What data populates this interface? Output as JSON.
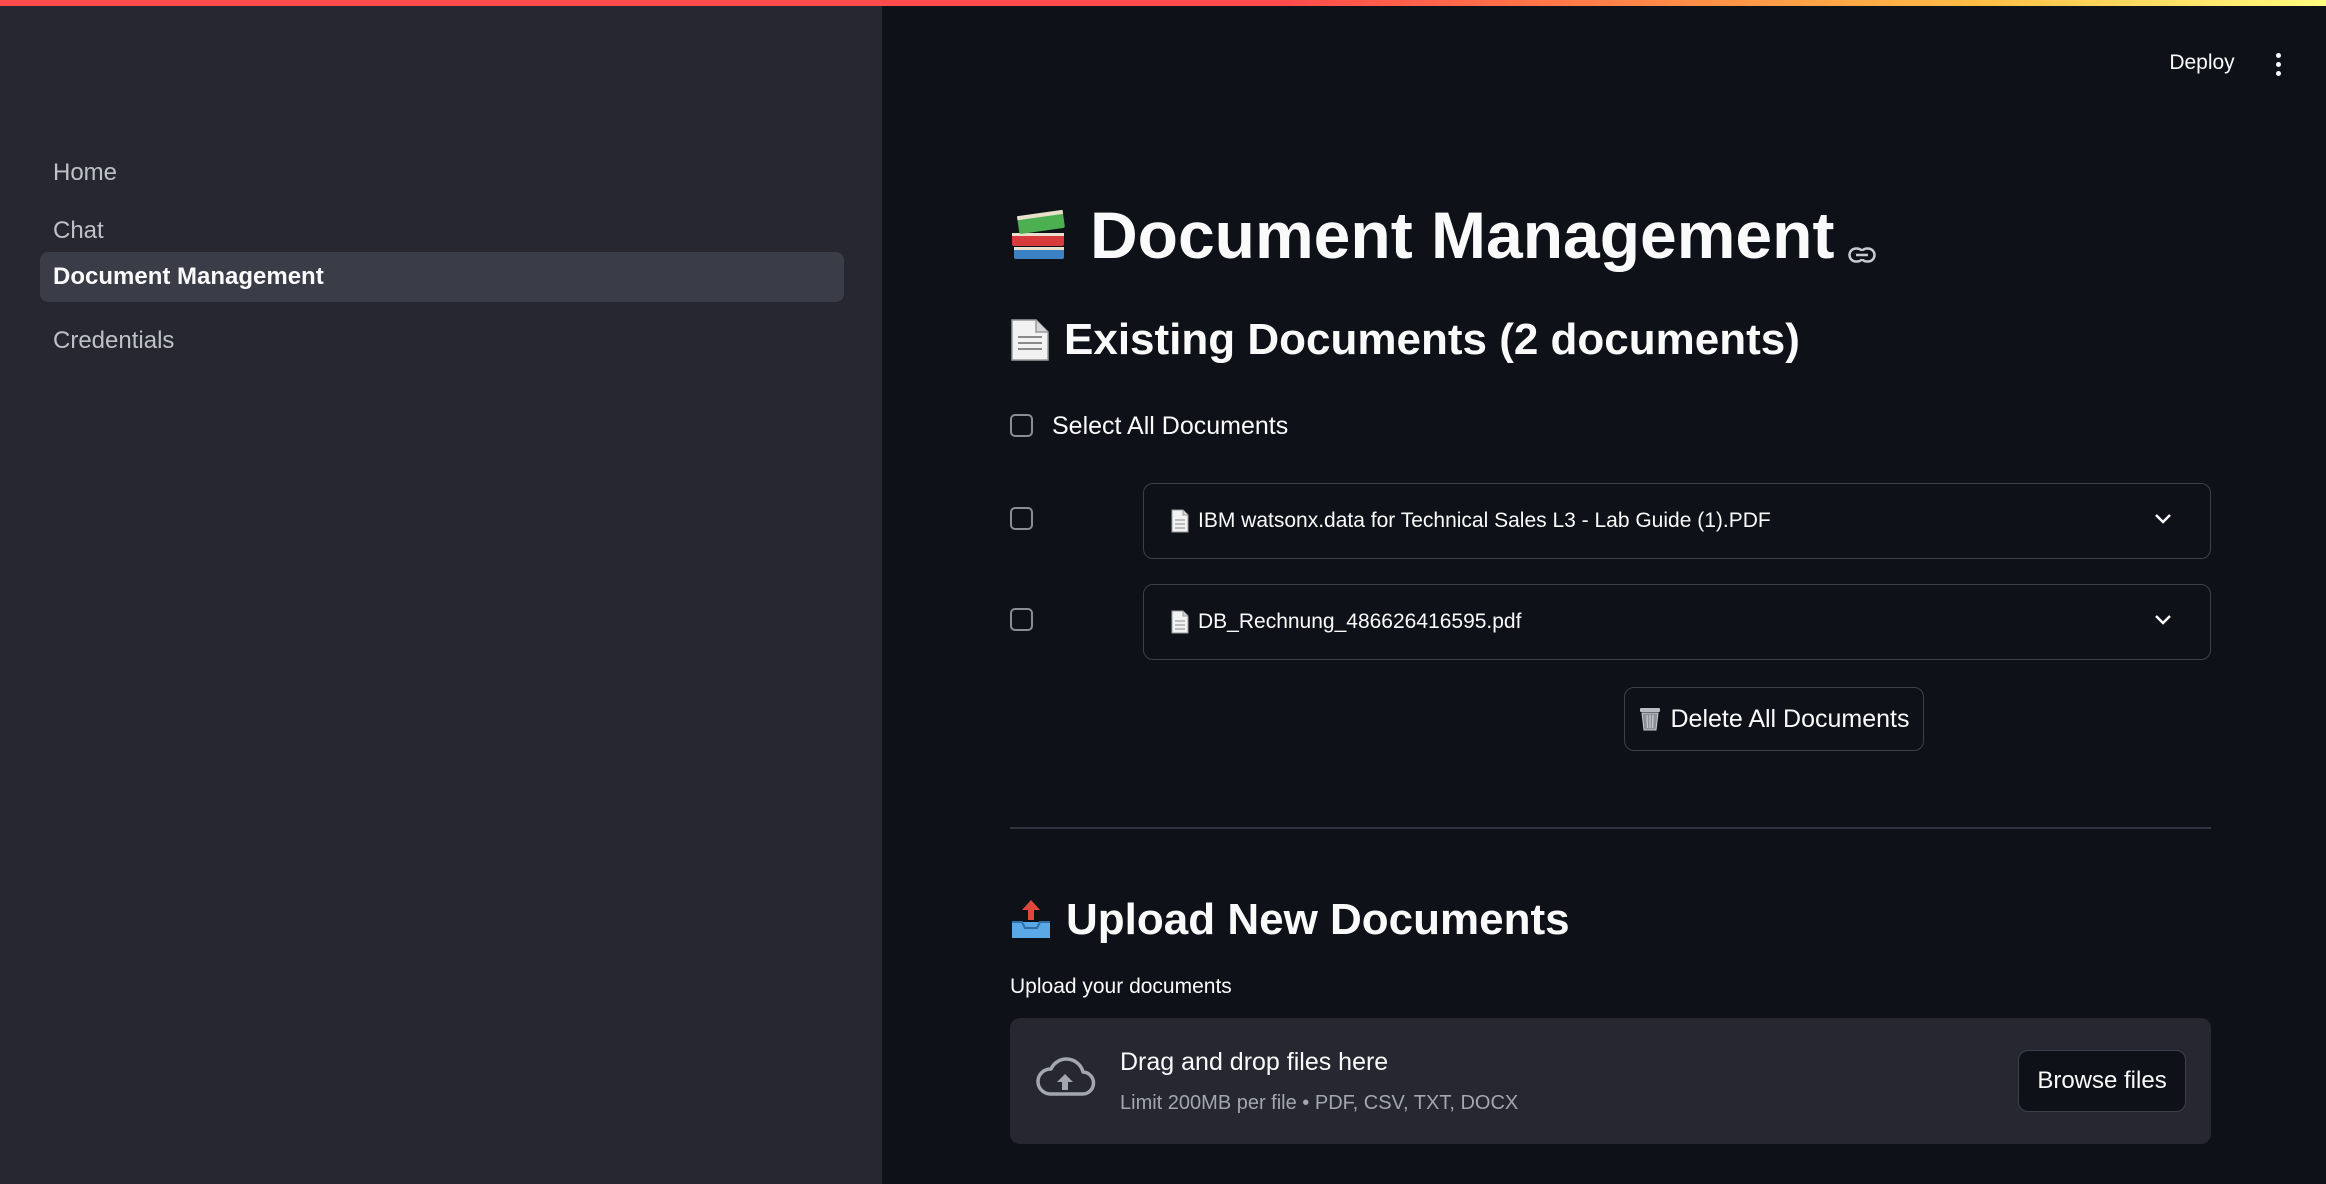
{
  "sidebar": {
    "items": [
      {
        "label": "Home",
        "active": false
      },
      {
        "label": "Chat",
        "active": false
      },
      {
        "label": "Document Management",
        "active": true
      },
      {
        "label": "Credentials",
        "active": false
      }
    ]
  },
  "header": {
    "deploy_label": "Deploy",
    "menu_icon": "kebab-menu-icon"
  },
  "main": {
    "title": "Document Management",
    "title_icon": "books-emoji",
    "existing": {
      "heading": "Existing Documents (2 documents)",
      "select_all_label": "Select All Documents",
      "select_all_checked": false,
      "documents": [
        {
          "name": "IBM watsonx.data for Technical Sales L3 - Lab Guide (1).PDF",
          "checked": false
        },
        {
          "name": "DB_Rechnung_486626416595.pdf",
          "checked": false
        }
      ],
      "delete_all_label": "Delete All Documents"
    },
    "upload": {
      "heading": "Upload New Documents",
      "field_label": "Upload your documents",
      "dropzone_title": "Drag and drop files here",
      "dropzone_subtitle": "Limit 200MB per file • PDF, CSV, TXT, DOCX",
      "browse_label": "Browse files"
    }
  },
  "colors": {
    "background": "#0e1117",
    "sidebar": "#262730",
    "accent": "#ff4b4b",
    "border": "#3d404b"
  }
}
